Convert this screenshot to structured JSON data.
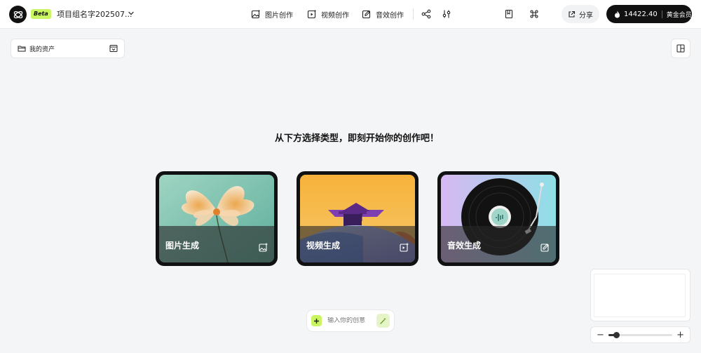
{
  "header": {
    "badge": "Beta",
    "project_title": "项目组名字202507...",
    "nav": [
      {
        "label": "图片创作",
        "icon": "image-sparkle-icon"
      },
      {
        "label": "视频创作",
        "icon": "video-sparkle-icon"
      },
      {
        "label": "音效创作",
        "icon": "audio-edit-icon"
      }
    ],
    "tool_icons": [
      "share-nodes-icon",
      "sliders-icon",
      "book-icon",
      "command-icon"
    ],
    "share_label": "分享",
    "credits": "14422.40",
    "membership": "黄金会员"
  },
  "sidebar": {
    "assets_label": "我的资产"
  },
  "main": {
    "headline": "从下方选择类型，即刻开始你的创作吧！",
    "cards": [
      {
        "label": "图片生成",
        "icon": "image-plus-icon"
      },
      {
        "label": "视频生成",
        "icon": "video-play-icon"
      },
      {
        "label": "音效生成",
        "icon": "pencil-square-icon"
      }
    ]
  },
  "prompt": {
    "placeholder": "输入你的创意"
  },
  "zoom": {
    "level": 0.12
  },
  "colors": {
    "accent": "#c8f560",
    "dark": "#111111",
    "background": "#f4f5f7"
  }
}
